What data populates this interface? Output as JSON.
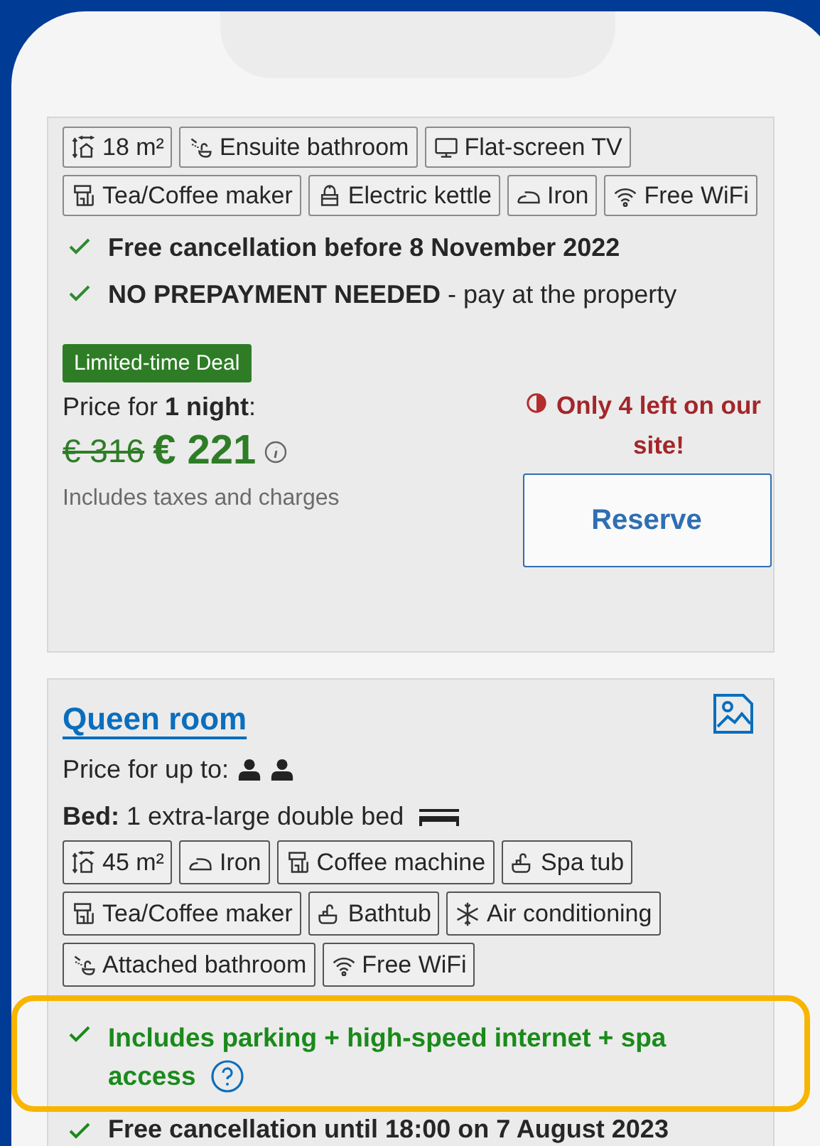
{
  "room_1": {
    "amenities": [
      {
        "kind": "area",
        "label": "18 m²"
      },
      {
        "kind": "shower",
        "label": "Ensuite bathroom"
      },
      {
        "kind": "tv",
        "label": "Flat-screen TV"
      },
      {
        "kind": "coffee",
        "label": "Tea/Coffee maker"
      },
      {
        "kind": "kettle",
        "label": "Electric kettle"
      },
      {
        "kind": "iron",
        "label": "Iron"
      },
      {
        "kind": "wifi",
        "label": "Free WiFi"
      }
    ],
    "conditions": [
      {
        "text": "Free cancellation before 8 November 2022",
        "bold": true
      },
      {
        "text": "**NO PREPAYMENT NEEDED** - pay at the property",
        "bold": false
      }
    ],
    "deal_badge": "Limited-time Deal",
    "price_label": "Price for **1 night**:",
    "old_price": "€ 316",
    "price": "€ 221",
    "taxes_note": "Includes taxes and charges",
    "scarcity": "Only 4 left on our site!",
    "reserve_button": "Reserve"
  },
  "room_2": {
    "name": "Queen room",
    "occupancy_label": "Price for up to:",
    "bed_label": "**Bed:** 1 extra-large double bed",
    "amenities": [
      {
        "kind": "area",
        "label": "45 m²"
      },
      {
        "kind": "iron",
        "label": "Iron"
      },
      {
        "kind": "coffee",
        "label": "Coffee machine"
      },
      {
        "kind": "bath",
        "label": "Spa tub"
      },
      {
        "kind": "coffee",
        "label": "Tea/Coffee maker"
      },
      {
        "kind": "bath",
        "label": "Bathtub"
      },
      {
        "kind": "snow",
        "label": "Air conditioning"
      },
      {
        "kind": "shower",
        "label": "Attached bathroom"
      },
      {
        "kind": "wifi",
        "label": "Free WiFi"
      }
    ],
    "highlight": {
      "text": "Includes parking + high-speed internet + spa access",
      "highlighted": true
    },
    "cancellation": "Free cancellation until 18:00  on 7 August 2023"
  }
}
